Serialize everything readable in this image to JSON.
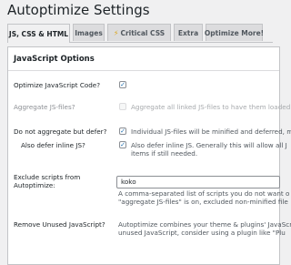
{
  "header": {
    "title": "Autoptimize Settings"
  },
  "tabs": [
    {
      "label": "JS, CSS & HTML",
      "active": true
    },
    {
      "label": "Images",
      "active": false
    },
    {
      "label": "Critical CSS",
      "active": false,
      "icon": "lightning-bolt-icon"
    },
    {
      "label": "Extra",
      "active": false
    },
    {
      "label": "Optimize More!",
      "active": false
    }
  ],
  "panel": {
    "title": "JavaScript Options",
    "rows": {
      "optimize_js": {
        "label": "Optimize JavaScript Code?",
        "checked": true
      },
      "aggregate_js": {
        "label": "Aggregate JS-files?",
        "checked": false,
        "disabled": true,
        "description": "Aggregate all linked JS-files to have them loaded"
      },
      "no_aggregate_defer": {
        "label": "Do not aggregate but defer?",
        "checked": true,
        "description": "Individual JS-files will be minified and deferred, m"
      },
      "defer_inline": {
        "label": "Also defer inline JS?",
        "checked": true,
        "description_line1": "Also defer inline JS. Generally this will allow all J",
        "description_line2": "items if still needed."
      },
      "exclude_scripts": {
        "label_line1": "Exclude scripts from",
        "label_line2": "Autoptimize:",
        "value": "koko",
        "description_line1": "A comma-separated list of scripts you do not want o",
        "description_line2": "\"aggregate JS-files\" is on, excluded non-minified file"
      },
      "remove_unused": {
        "label": "Remove Unused JavaScript?",
        "description_line1": "Autoptimize combines your theme & plugins' JavaScr",
        "description_line2": "unused JavaScript, consider using a plugin like \"Plu"
      }
    }
  },
  "colors": {
    "accent": "#2271b1",
    "background": "#f0f0f1",
    "bolt": "#dba617"
  }
}
